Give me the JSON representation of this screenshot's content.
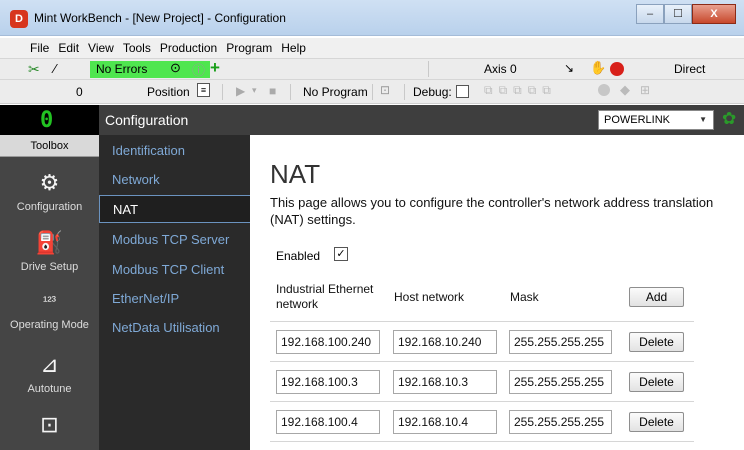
{
  "window": {
    "title": "Mint WorkBench - [New Project] - Configuration",
    "minimize": "–",
    "maximize": "☐",
    "close": "X"
  },
  "menu": [
    "File",
    "Edit",
    "View",
    "Tools",
    "Production",
    "Program",
    "Help"
  ],
  "toolbar": {
    "status": "No Errors",
    "axis": "Axis 0",
    "mode": "Direct",
    "counter": "0",
    "position": "Position",
    "program": "No Program",
    "debug": "Debug:"
  },
  "header": {
    "title": "Configuration",
    "bus_select": "POWERLINK"
  },
  "toolbox": {
    "title": "Toolbox",
    "items": [
      "Configuration",
      "Drive Setup",
      "Operating Mode",
      "Autotune"
    ],
    "icons": [
      "wrench-icon",
      "drive-icon",
      "counter-icon",
      "autotune-icon",
      "scope-icon"
    ]
  },
  "nav": {
    "items": [
      "Identification",
      "Network",
      "NAT",
      "Modbus TCP Server",
      "Modbus TCP Client",
      "EtherNet/IP",
      "NetData Utilisation"
    ],
    "active_index": 2
  },
  "page": {
    "title": "NAT",
    "description": "This page allows you to configure the controller's network address translation (NAT) settings.",
    "enabled_label": "Enabled",
    "enabled": true,
    "columns": {
      "industrial": "Industrial Ethernet network",
      "host": "Host network",
      "mask": "Mask"
    },
    "add_label": "Add",
    "delete_label": "Delete",
    "rows": [
      {
        "industrial": "192.168.100.240",
        "host": "192.168.10.240",
        "mask": "255.255.255.255"
      },
      {
        "industrial": "192.168.100.3",
        "host": "192.168.10.3",
        "mask": "255.255.255.255"
      },
      {
        "industrial": "192.168.100.4",
        "host": "192.168.10.4",
        "mask": "255.255.255.255"
      }
    ]
  },
  "colors": {
    "status_ok": "#4fe64f",
    "nav_link": "#7fa9d6",
    "header_bg": "#3e3e3e"
  }
}
